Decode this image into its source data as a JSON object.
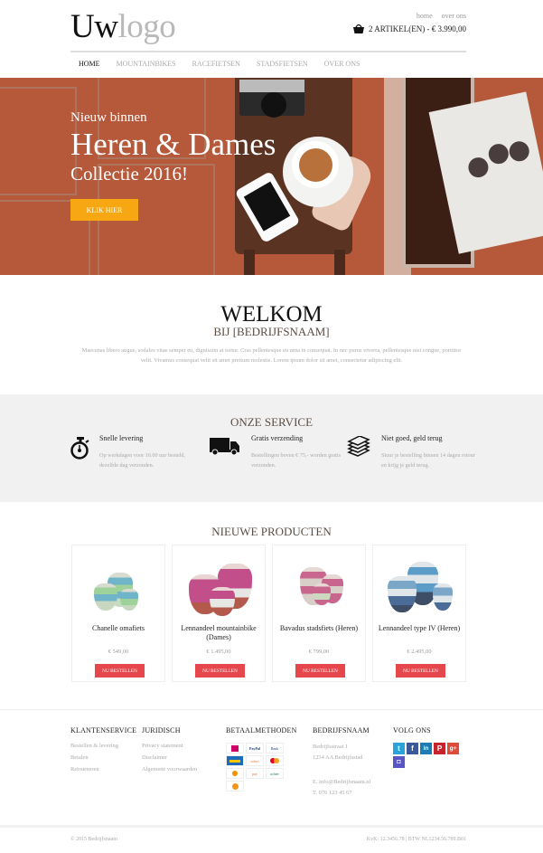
{
  "header": {
    "logo_bold": "Uw",
    "logo_light": "logo",
    "top_links": [
      "home",
      "over ons"
    ],
    "cart_label": "2 ARTIKEL(EN) - € 3.990,00"
  },
  "nav": {
    "items": [
      "HOME",
      "MOUNTAINBIKES",
      "RACEFIETSEN",
      "STADSFIETSEN",
      "OVER ONS"
    ],
    "active": "HOME"
  },
  "hero": {
    "kicker": "Nieuw binnen",
    "title": "Heren & Dames",
    "subtitle": "Collectie 2016!",
    "cta_label": "KLIK HIER",
    "cta_color": "#f7a712"
  },
  "welcome": {
    "title": "WELKOM",
    "subtitle": "BIJ [BEDRIJFSNAAM]",
    "text": "Maecenas libero augue, sodales vitae semper eu, dignissim at tortor. Cras pellentesque eu urna in consequat. In nec purus viverra, pellentesque nisi congue, porttitor velit. Vivamus consequat velit sit amet pretium molestie. Lorem ipsum dolor sit amet, consectetur adipiscing elit."
  },
  "service": {
    "title": "ONZE SERVICE",
    "items": [
      {
        "icon": "stopwatch-icon",
        "title": "Snelle levering",
        "text": "Op werkdagen voor 16.00 uur besteld, dezelfde dag verzonden."
      },
      {
        "icon": "truck-icon",
        "title": "Gratis verzending",
        "text": "Bestellingen boven € 75,- worden gratis verzonden."
      },
      {
        "icon": "money-stack-icon",
        "title": "Niet goed, geld terug",
        "text": "Stuur je bestelling binnen 14 dagen retour en krijg je geld terug."
      }
    ]
  },
  "products": {
    "title": "NIEUWE PRODUCTEN",
    "button_label": "NU BESTELLEN",
    "button_color": "#e5474d",
    "items": [
      {
        "name": "Chanelle omafiets",
        "price": "€ 549,00"
      },
      {
        "name": "Lennandeel mountainbike (Dames)",
        "price": "€ 1.495,00"
      },
      {
        "name": "Bavadus stadsfiets (Heren)",
        "price": "€ 799,00"
      },
      {
        "name": "Lennandeel type IV (Heren)",
        "price": "€ 2.495,00"
      }
    ]
  },
  "footer": {
    "klantenservice": {
      "title": "KLANTENSERVICE",
      "links": [
        "Bestellen & levering",
        "Betalen",
        "Retourneren"
      ]
    },
    "juridisch": {
      "title": "JURIDISCH",
      "links": [
        "Privacy statement",
        "Disclaimer",
        "Algemene voorwaarden"
      ]
    },
    "betaalmethoden": {
      "title": "BETAALMETHODEN",
      "methods": [
        "iDEAL",
        "PayPal",
        "Bank Overboeking",
        "Bancontact Mister Cash",
        "Sofort",
        "Mastercard",
        "Overboeking",
        "Afterpay",
        "Achteraf Betalen",
        "Bitcoin"
      ]
    },
    "bedrijf": {
      "title": "BEDRIJFSNAAM",
      "address1": "Bedrijfsstraat 1",
      "address2": "1234 AA Bedrijfsstad",
      "email": "E. info@Bedrijfsnaam.nl",
      "phone": "T. 076 123 45 67"
    },
    "social": {
      "title": "VOLG ONS",
      "networks": [
        {
          "name": "twitter",
          "glyph": "t",
          "color": "#2aa3d9"
        },
        {
          "name": "facebook",
          "glyph": "f",
          "color": "#3b5998"
        },
        {
          "name": "linkedin",
          "glyph": "in",
          "color": "#1d7bb5"
        },
        {
          "name": "pinterest",
          "glyph": "P",
          "color": "#c8232c"
        },
        {
          "name": "google-plus",
          "glyph": "g+",
          "color": "#dd4b39"
        },
        {
          "name": "instagram",
          "glyph": "◘",
          "color": "#5856c4"
        }
      ]
    },
    "copyright": "© 2015 Bedrijfsnaam",
    "registration": "KvK: 12.3456.78 | BTW NL1234.56.789.B01"
  }
}
